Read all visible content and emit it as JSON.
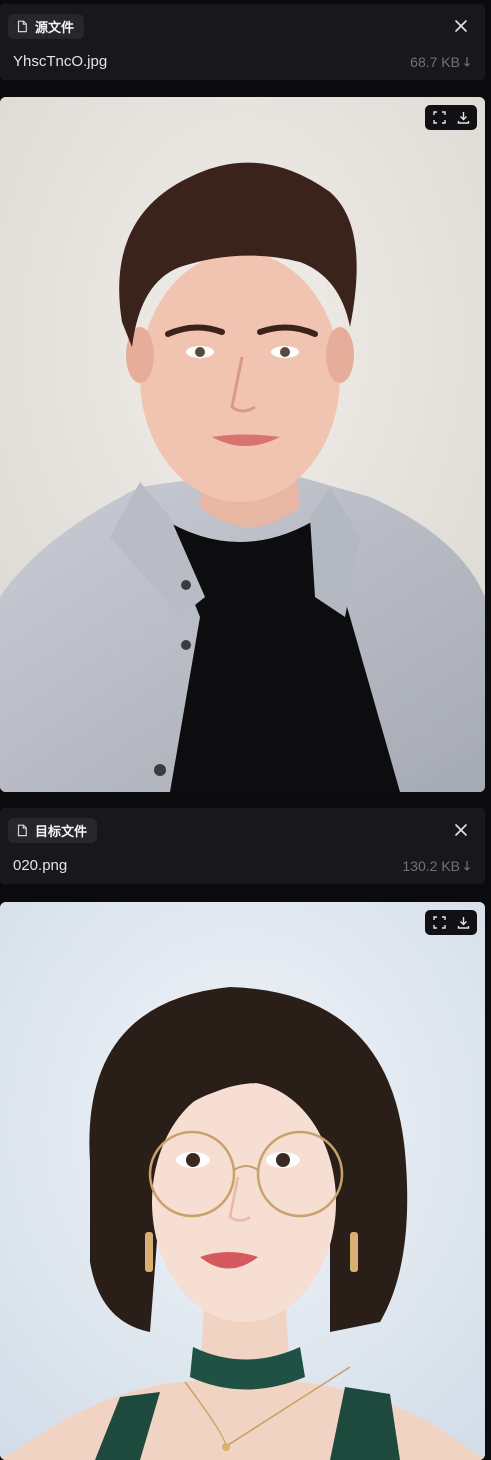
{
  "source": {
    "badge_label": "源文件",
    "file_name": "YhscTncO.jpg",
    "file_size": "68.7 KB",
    "image_alt": "Portrait of a young man with short brown hair wearing a light gray shirt over a black t-shirt"
  },
  "target": {
    "badge_label": "目标文件",
    "file_name": "020.png",
    "file_size": "130.2 KB",
    "image_alt": "Portrait of a young woman with a dark bob haircut, round gold glasses and a green choker"
  },
  "icons": {
    "badge": "file-icon",
    "close": "close-icon",
    "size": "arrow-down-icon",
    "fullscreen": "fullscreen-icon",
    "download": "download-icon"
  },
  "colors": {
    "background": "#0b0b0d",
    "card": "#18181b",
    "badge": "#27272a",
    "text": "#e4e4e7",
    "muted": "#71717a"
  }
}
